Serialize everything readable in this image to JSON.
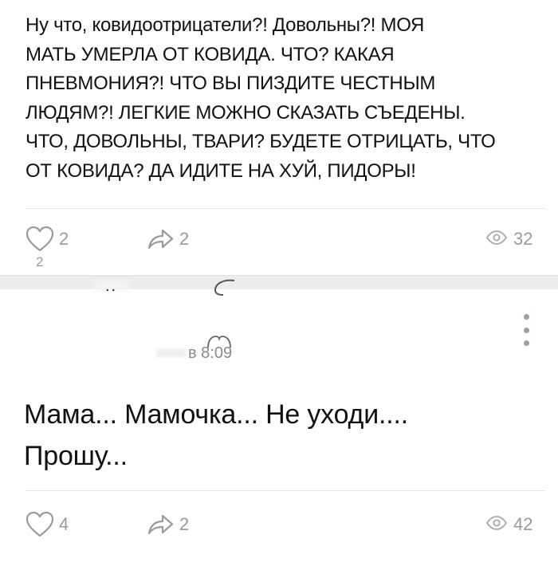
{
  "colors": {
    "text": "#111111",
    "muted": "#9a9a9a",
    "divider": "#e6e6e6",
    "separator_band": "#ececec",
    "menu_dots": "#9aa0a8"
  },
  "post1": {
    "text": "Ну что, ковидоотрицатели?! Довольны?! МОЯ\nМАТЬ УМЕРЛА ОТ КОВИДА. ЧТО? КАКАЯ\nПНЕВМОНИЯ?! ЧТО ВЫ ПИЗДИТЕ ЧЕСТНЫМ\nЛЮДЯМ?! ЛЕГКИЕ МОЖНО СКАЗАТЬ СЪЕДЕНЫ.\nЧТО, ДОВОЛЬНЫ, ТВАРИ? БУДЕТЕ ОТРИЦАТЬ, ЧТО\nОТ КОВИДА? ДА ИДИТЕ НА ХУЙ, ПИДОРЫ!",
    "likes": "2",
    "shares": "2",
    "views": "32",
    "stray_digit": "2",
    "icons": {
      "like": "heart-icon",
      "share": "share-arrow-icon",
      "views": "eye-icon"
    }
  },
  "post2": {
    "author": "..",
    "time": "в 8:09",
    "text": "Мама... Мамочка... Не уходи....\nПрошу...",
    "likes": "4",
    "shares": "2",
    "views": "42",
    "icons": {
      "like": "heart-icon",
      "share": "share-arrow-icon",
      "views": "eye-icon",
      "menu": "more-vertical-icon"
    }
  }
}
